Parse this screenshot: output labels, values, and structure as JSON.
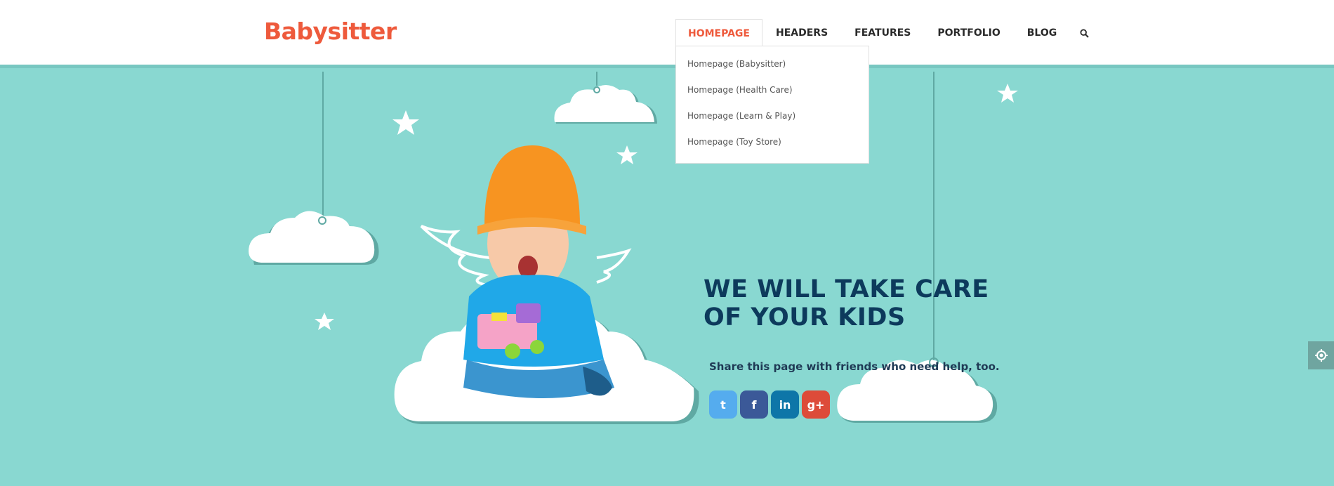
{
  "brand": {
    "logo_text": "Babysitter",
    "accent": "#ee5a3c"
  },
  "nav": {
    "items": [
      {
        "label": "HOMEPAGE",
        "active": true
      },
      {
        "label": "HEADERS"
      },
      {
        "label": "FEATURES"
      },
      {
        "label": "PORTFOLIO"
      },
      {
        "label": "BLOG"
      }
    ],
    "search_icon": "search-icon"
  },
  "dropdown": {
    "items": [
      "Homepage (Babysitter)",
      "Homepage (Health Care)",
      "Homepage (Learn & Play)",
      "Homepage (Toy Store)"
    ]
  },
  "hero": {
    "headline_line1": "WE WILL TAKE CARE",
    "headline_line2": "OF YOUR KIDS",
    "share_text": "Share this page with friends who need help, too.",
    "background": "#89d8d1",
    "headline_color": "#0d3a5c"
  },
  "socials": [
    {
      "name": "twitter",
      "glyph": "t",
      "color": "#55acee"
    },
    {
      "name": "facebook",
      "glyph": "f",
      "color": "#3b5998"
    },
    {
      "name": "linkedin",
      "glyph": "in",
      "color": "#0e76a8"
    },
    {
      "name": "google-plus",
      "glyph": "g+",
      "color": "#dd4b39"
    }
  ],
  "settings_icon": "gear-icon"
}
